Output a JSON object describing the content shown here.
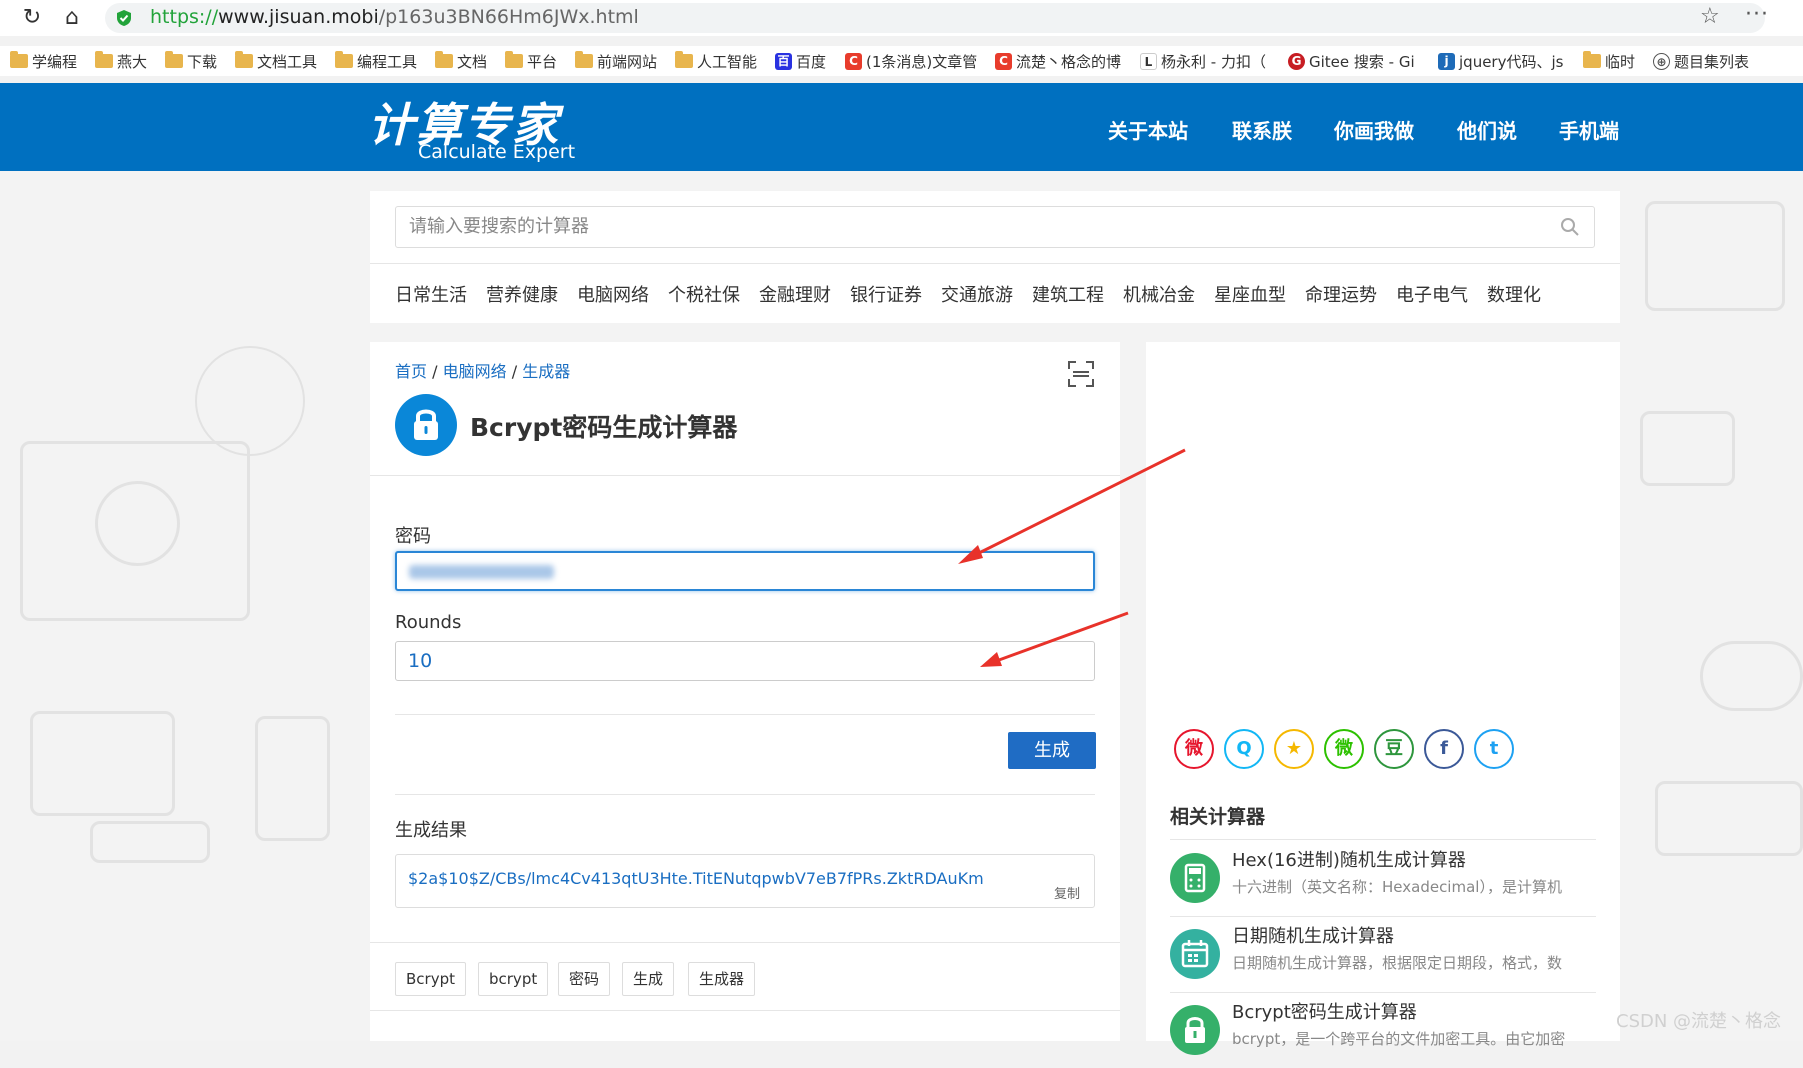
{
  "browser": {
    "url_scheme": "https://",
    "url_host": "www.jisuan.mobi",
    "url_path": "/p163u3BN66Hm6JWx.html",
    "bookmarks": [
      {
        "label": "学编程",
        "icon": "folder-icon"
      },
      {
        "label": "燕大",
        "icon": "folder-icon"
      },
      {
        "label": "下载",
        "icon": "folder-icon"
      },
      {
        "label": "文档工具",
        "icon": "folder-icon"
      },
      {
        "label": "编程工具",
        "icon": "folder-icon"
      },
      {
        "label": "文档",
        "icon": "folder-icon"
      },
      {
        "label": "平台",
        "icon": "folder-icon"
      },
      {
        "label": "前端网站",
        "icon": "folder-icon"
      },
      {
        "label": "人工智能",
        "icon": "folder-icon"
      },
      {
        "label": "百度",
        "icon": "baidu-icon"
      },
      {
        "label": "(1条消息)文章管",
        "icon": "csdn-icon"
      },
      {
        "label": "流楚丶格念的博",
        "icon": "csdn-icon"
      },
      {
        "label": "杨永利 - 力扣（",
        "icon": "leetcode-icon"
      },
      {
        "label": "Gitee 搜索 - Gi",
        "icon": "gitee-icon"
      },
      {
        "label": "jquery代码、js",
        "icon": "jquery-icon"
      },
      {
        "label": "临时",
        "icon": "folder-icon"
      },
      {
        "label": "题目集列表",
        "icon": "globe-icon"
      }
    ]
  },
  "header": {
    "logo_cn": "计算专家",
    "logo_en": "Calculate Expert",
    "nav": [
      "关于本站",
      "联系朕",
      "你画我做",
      "他们说",
      "手机端"
    ]
  },
  "search": {
    "placeholder": "请输入要搜索的计算器",
    "categories": [
      "日常生活",
      "营养健康",
      "电脑网络",
      "个税社保",
      "金融理财",
      "银行证券",
      "交通旅游",
      "建筑工程",
      "机械冶金",
      "星座血型",
      "命理运势",
      "电子电气",
      "数理化"
    ]
  },
  "calculator": {
    "breadcrumb": [
      "首页",
      "电脑网络",
      "生成器"
    ],
    "breadcrumb_sep": "/",
    "title": "Bcrypt密码生成计算器",
    "password_label": "密码",
    "rounds_label": "Rounds",
    "rounds_value": "10",
    "generate_label": "生成",
    "result_label": "生成结果",
    "result_value": "$2a$10$Z/CBs/lmc4Cv413qtU3Hte.TitENutqpwbV7eB7fPRs.ZktRDAuKm",
    "copy_label": "复制",
    "tags": [
      "Bcrypt",
      "bcrypt",
      "密码",
      "生成",
      "生成器"
    ]
  },
  "sidebar": {
    "share_icons": [
      {
        "name": "weibo-icon",
        "glyph": "微",
        "color": "#e6162d"
      },
      {
        "name": "qq-icon",
        "glyph": "Q",
        "color": "#12b7f5"
      },
      {
        "name": "qzone-icon",
        "glyph": "★",
        "color": "#f5b800"
      },
      {
        "name": "wechat-icon",
        "glyph": "微",
        "color": "#2dc100"
      },
      {
        "name": "douban-icon",
        "glyph": "豆",
        "color": "#2e963d"
      },
      {
        "name": "facebook-icon",
        "glyph": "f",
        "color": "#3b5998"
      },
      {
        "name": "twitter-icon",
        "glyph": "t",
        "color": "#1da1f2"
      }
    ],
    "related_title": "相关计算器",
    "related": [
      {
        "name": "Hex(16进制)随机生成计算器",
        "desc": "十六进制（英文名称：Hexadecimal），是计算机",
        "color": "#35b06a",
        "icon": "calculator-icon"
      },
      {
        "name": "日期随机生成计算器",
        "desc": "日期随机生成计算器，根据限定日期段，格式，数",
        "color": "#34b1a0",
        "icon": "calendar-icon"
      },
      {
        "name": "Bcrypt密码生成计算器",
        "desc": "bcrypt，是一个跨平台的文件加密工具。由它加密",
        "color": "#35b06a",
        "icon": "lock-icon"
      }
    ]
  },
  "watermark": "CSDN @流楚丶格念"
}
